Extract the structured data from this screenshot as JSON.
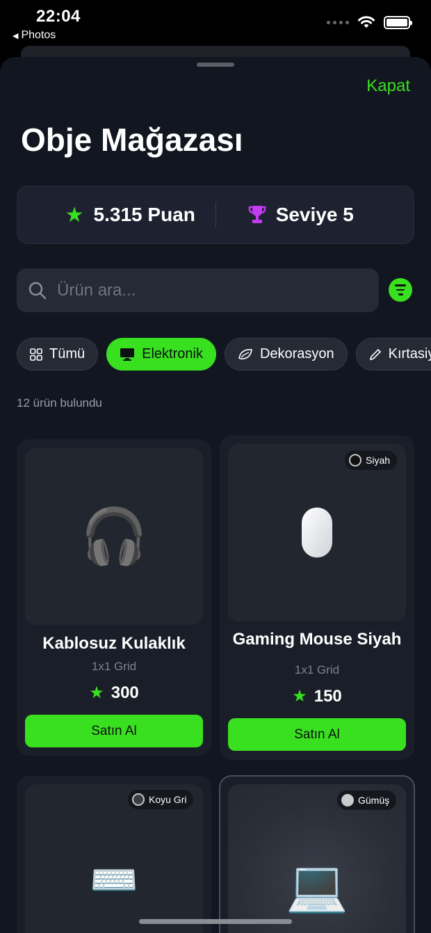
{
  "status_bar": {
    "time": "22:04",
    "back_label": "Photos"
  },
  "header": {
    "close_label": "Kapat",
    "title": "Obje Mağazası"
  },
  "stats": {
    "points": "5.315 Puan",
    "level": "Seviye 5"
  },
  "search": {
    "placeholder": "Ürün ara..."
  },
  "categories": [
    {
      "label": "Tümü",
      "icon": "grid-icon",
      "active": false
    },
    {
      "label": "Elektronik",
      "icon": "monitor-icon",
      "active": true
    },
    {
      "label": "Dekorasyon",
      "icon": "leaf-icon",
      "active": false
    },
    {
      "label": "Kırtasiye",
      "icon": "pencil-icon",
      "active": false
    }
  ],
  "result_count": "12 ürün bulundu",
  "products": [
    {
      "name": "Kablosuz Kulaklık",
      "size": "1x1 Grid",
      "price": "300",
      "buy": "Satın Al",
      "emoji": "🎧",
      "color_label": ""
    },
    {
      "name": "Gaming Mouse Siyah",
      "size": "1x1 Grid",
      "price": "150",
      "buy": "Satın Al",
      "emoji": "",
      "color_label": "Siyah"
    },
    {
      "name": "",
      "size": "",
      "price": "",
      "buy": "",
      "emoji": "⌨️",
      "color_label": "Koyu Gri"
    },
    {
      "name": "",
      "size": "",
      "price": "",
      "buy": "",
      "emoji": "💻",
      "color_label": "Gümüş"
    }
  ],
  "colors": {
    "accent": "#39e01f",
    "background": "#121620",
    "card": "#1a1e28",
    "trophy": "#c23cf0"
  }
}
